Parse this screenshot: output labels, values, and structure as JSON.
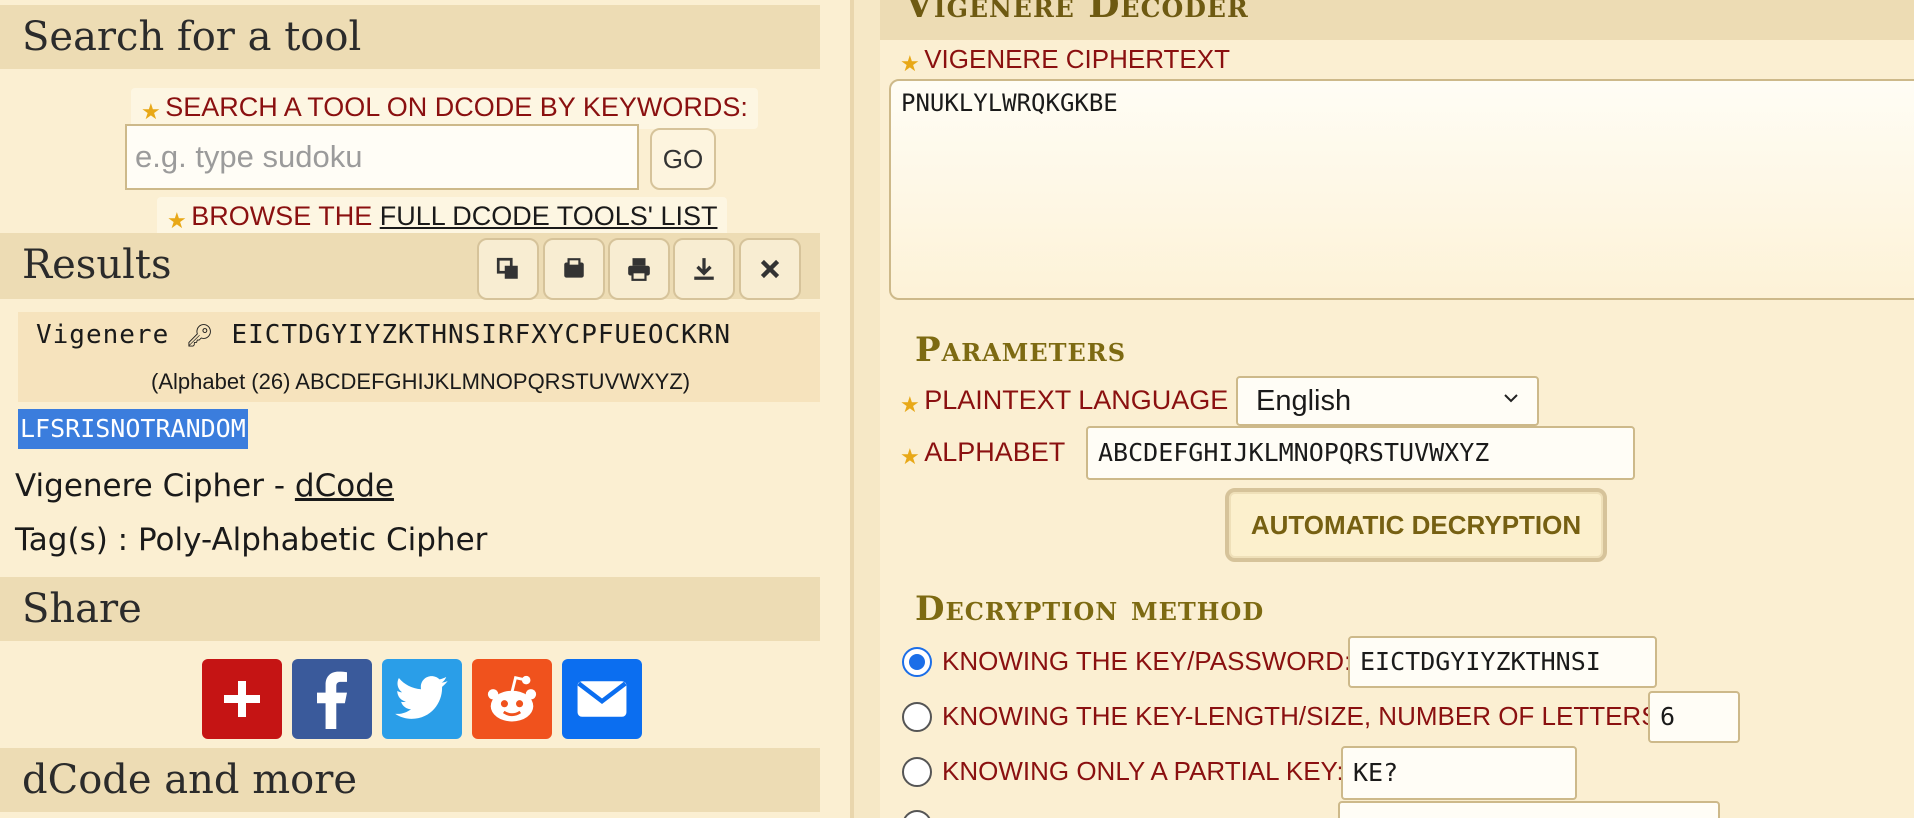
{
  "sidebar": {
    "search_title": "Search for a tool",
    "search_label": "SEARCH A TOOL ON DCODE BY KEYWORDS:",
    "search_placeholder": "e.g. type sudoku",
    "go_label": "GO",
    "browse_prefix": "BROWSE THE ",
    "browse_link": "FULL DCODE TOOLS' LIST",
    "results_title": "Results",
    "result_tool": "Vigenere",
    "result_key": "EICTDGYIYZKTHNSIRFXYCPFUEOCKRN",
    "result_alphabet": "(Alphabet (26) ABCDEFGHIJKLMNOPQRSTUVWXYZ)",
    "result_plaintext": "LFSRISNOTRANDOM",
    "cipher_line_prefix": "Vigenere Cipher - ",
    "cipher_line_link": "dCode",
    "tags_line": "Tag(s) : Poly-Alphabetic Cipher",
    "share_title": "Share",
    "more_title": "dCode and more",
    "toolbar_icons": [
      "copy-icon",
      "clipboard-icon",
      "print-icon",
      "download-icon",
      "close-icon"
    ],
    "share_icons": [
      "addthis-icon",
      "facebook-icon",
      "twitter-icon",
      "reddit-icon",
      "email-icon"
    ]
  },
  "main": {
    "title": "Vigenere Decoder",
    "ciphertext_label": "VIGENERE CIPHERTEXT",
    "ciphertext_value": "PNUKLYLWRQKGKBE",
    "parameters_title": "Parameters",
    "language_label": "PLAINTEXT LANGUAGE",
    "language_value": "English",
    "alphabet_label": "ALPHABET",
    "alphabet_value": "ABCDEFGHIJKLMNOPQRSTUVWXYZ",
    "auto_button": "AUTOMATIC DECRYPTION",
    "method_title": "Decryption method",
    "method_key_label": "KNOWING THE KEY/PASSWORD:",
    "method_key_value": "EICTDGYIYZKTHNSI",
    "method_length_label": "KNOWING THE KEY-LENGTH/SIZE, NUMBER OF LETTERS:",
    "method_length_value": "6",
    "method_partial_label": "KNOWING ONLY A PARTIAL KEY:",
    "method_partial_value": "KE?"
  },
  "colors": {
    "accent_red": "#8a1010",
    "header_olive": "#6e5a12",
    "selection_blue": "#3b7ddd",
    "radio_blue": "#1b6ee8"
  }
}
